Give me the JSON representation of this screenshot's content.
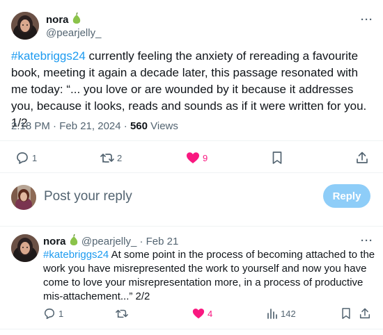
{
  "tweet": {
    "author_name": "nora",
    "author_handle": "@pearjelly_",
    "hashtag": "#katebriggs24",
    "text": " currently feeling the anxiety of rereading a favourite book, meeting it again a decade later, this passage resonated with me today: “... you love or are wounded by it because it addresses you, because it looks, reads and sounds as if it were written for you. 1/2",
    "time": "2:18 PM · Feb 21, 2024 · ",
    "views_count": "560",
    "views_label": " Views",
    "actions": {
      "replies": "1",
      "reposts": "2",
      "likes": "9"
    }
  },
  "composer": {
    "placeholder": "Post your reply",
    "button_label": "Reply"
  },
  "reply": {
    "author_name": "nora",
    "author_handle": "@pearjelly_",
    "date": " · Feb 21",
    "hashtag": "#katebriggs24",
    "text": " At some point in the process of becoming attached to the work you have misrepresented the work to yourself and now you have come to love your misrepresentation more, in a process of productive mis-attachement...” 2/2",
    "actions": {
      "replies": "1",
      "likes": "4",
      "views": "142"
    }
  },
  "icons": {
    "leaf_color": "#7cb342",
    "like_color": "#f91880",
    "link_color": "#1d9bf0"
  }
}
